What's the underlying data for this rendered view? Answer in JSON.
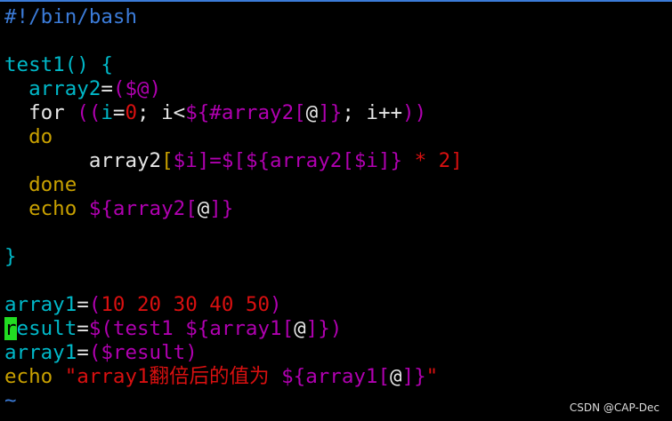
{
  "colors": {
    "background": "#000000",
    "plain": "#e6e6e6",
    "cyan": "#00b8c8",
    "magenta": "#b000b0",
    "red": "#d81010",
    "yellow": "#c8a000",
    "blue": "#3b7bd8",
    "cursor": "#22dd22"
  },
  "editor": {
    "filename_hidden": "",
    "lines": [
      [
        {
          "t": "#!/bin/bash",
          "c": "blue"
        }
      ],
      [],
      [
        {
          "t": "test1",
          "c": "cyan"
        },
        {
          "t": "() {",
          "c": "cyan"
        }
      ],
      [
        {
          "t": "  ",
          "c": "plain"
        },
        {
          "t": "array2",
          "c": "cyan"
        },
        {
          "t": "=",
          "c": "plain"
        },
        {
          "t": "(",
          "c": "magenta"
        },
        {
          "t": "$@",
          "c": "magenta"
        },
        {
          "t": ")",
          "c": "magenta"
        }
      ],
      [
        {
          "t": "  ",
          "c": "plain"
        },
        {
          "t": "for ",
          "c": "plain"
        },
        {
          "t": "((",
          "c": "magenta"
        },
        {
          "t": "i",
          "c": "cyan"
        },
        {
          "t": "=",
          "c": "plain"
        },
        {
          "t": "0",
          "c": "red"
        },
        {
          "t": "; i<",
          "c": "plain"
        },
        {
          "t": "${#array2[",
          "c": "magenta"
        },
        {
          "t": "@",
          "c": "plain"
        },
        {
          "t": "]}",
          "c": "magenta"
        },
        {
          "t": "; i++",
          "c": "plain"
        },
        {
          "t": "))",
          "c": "magenta"
        }
      ],
      [
        {
          "t": "  ",
          "c": "plain"
        },
        {
          "t": "do",
          "c": "yellow"
        }
      ],
      [
        {
          "t": "       ",
          "c": "plain"
        },
        {
          "t": "array2",
          "c": "plain"
        },
        {
          "t": "[",
          "c": "yellow"
        },
        {
          "t": "$i",
          "c": "magenta"
        },
        {
          "t": "]=",
          "c": "magenta"
        },
        {
          "t": "$[",
          "c": "magenta"
        },
        {
          "t": "${array2[",
          "c": "magenta"
        },
        {
          "t": "$i",
          "c": "magenta"
        },
        {
          "t": "]}",
          "c": "magenta"
        },
        {
          "t": " * 2]",
          "c": "red"
        }
      ],
      [
        {
          "t": "  ",
          "c": "plain"
        },
        {
          "t": "done",
          "c": "yellow"
        }
      ],
      [
        {
          "t": "  ",
          "c": "plain"
        },
        {
          "t": "echo ",
          "c": "yellow"
        },
        {
          "t": "${array2[",
          "c": "magenta"
        },
        {
          "t": "@",
          "c": "plain"
        },
        {
          "t": "]}",
          "c": "magenta"
        }
      ],
      [],
      [
        {
          "t": "}",
          "c": "cyan"
        }
      ],
      [],
      [
        {
          "t": "array1",
          "c": "cyan"
        },
        {
          "t": "=",
          "c": "plain"
        },
        {
          "t": "(",
          "c": "magenta"
        },
        {
          "t": "10 20 30 40 50",
          "c": "red"
        },
        {
          "t": ")",
          "c": "magenta"
        }
      ],
      [
        {
          "t": "r",
          "c": "cursor"
        },
        {
          "t": "esult",
          "c": "cyan"
        },
        {
          "t": "=",
          "c": "plain"
        },
        {
          "t": "$(",
          "c": "magenta"
        },
        {
          "t": "test1 ",
          "c": "magenta"
        },
        {
          "t": "${array1[",
          "c": "magenta"
        },
        {
          "t": "@",
          "c": "plain"
        },
        {
          "t": "]}",
          "c": "magenta"
        },
        {
          "t": ")",
          "c": "magenta"
        }
      ],
      [
        {
          "t": "array1",
          "c": "cyan"
        },
        {
          "t": "=",
          "c": "plain"
        },
        {
          "t": "(",
          "c": "magenta"
        },
        {
          "t": "$result",
          "c": "magenta"
        },
        {
          "t": ")",
          "c": "magenta"
        }
      ],
      [
        {
          "t": "echo ",
          "c": "yellow"
        },
        {
          "t": "\"array1翻倍后的值为 ",
          "c": "red"
        },
        {
          "t": "${array1[",
          "c": "magenta"
        },
        {
          "t": "@",
          "c": "plain"
        },
        {
          "t": "]}",
          "c": "magenta"
        },
        {
          "t": "\"",
          "c": "red"
        }
      ],
      [
        {
          "t": "~",
          "c": "blue"
        }
      ]
    ]
  },
  "watermark": "CSDN @CAP-Dec"
}
